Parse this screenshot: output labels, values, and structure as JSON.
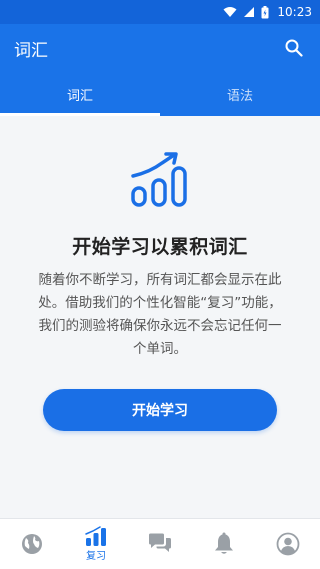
{
  "status_bar": {
    "time": "10:23"
  },
  "app_bar": {
    "title": "词汇"
  },
  "tabs": [
    {
      "label": "词汇",
      "active": true
    },
    {
      "label": "语法",
      "active": false
    }
  ],
  "main": {
    "headline": "开始学习以累积词汇",
    "description": "随着你不断学习，所有词汇都会显示在此处。借助我们的个性化智能“复习”功能，我们的测验将确保你永远不会忘记任何一个单词。",
    "start_button": "开始学习"
  },
  "bottom_nav": {
    "items": [
      {
        "icon": "globe-icon",
        "label": "",
        "active": false
      },
      {
        "icon": "bar-chart-icon",
        "label": "复习",
        "active": true
      },
      {
        "icon": "chat-icon",
        "label": "",
        "active": false
      },
      {
        "icon": "bell-icon",
        "label": "",
        "active": false
      },
      {
        "icon": "profile-icon",
        "label": "",
        "active": false
      }
    ]
  },
  "colors": {
    "primary": "#1a73e8",
    "status_bar": "#1364d9",
    "nav_inactive": "#9aa0a6"
  }
}
